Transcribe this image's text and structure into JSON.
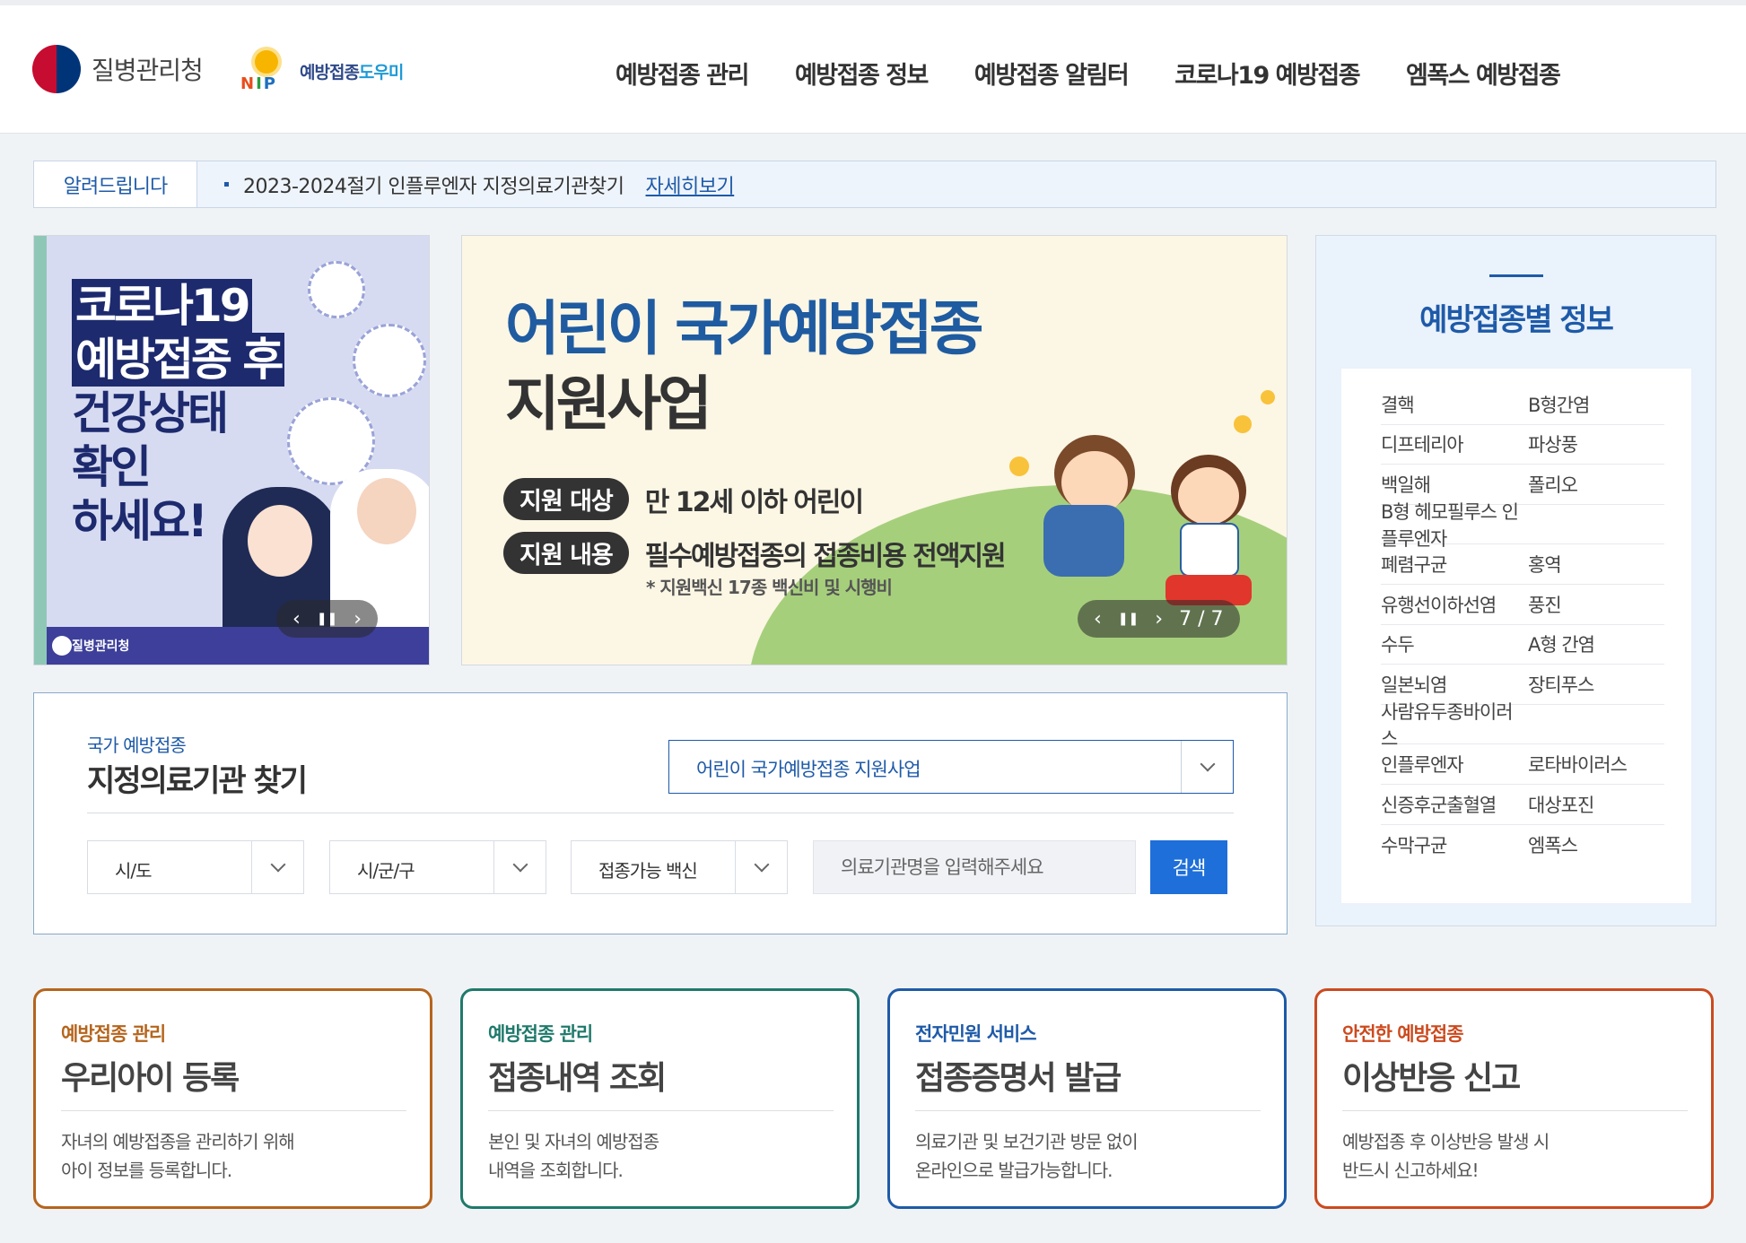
{
  "header": {
    "kdca_logo_text": "질병관리청",
    "nip_letters": [
      "N",
      "I",
      "P"
    ],
    "nip_text_a": "예방접종",
    "nip_text_b": "도우미",
    "nav": [
      "예방접종 관리",
      "예방접종 정보",
      "예방접종 알림터",
      "코로나19 예방접종",
      "엠폭스 예방접종"
    ]
  },
  "notice": {
    "label": "알려드립니다",
    "text": "2023-2024절기 인플루엔자 지정의료기관찾기",
    "link": "자세히보기"
  },
  "banner_left": {
    "line1": "코로나19",
    "line2": "예방접종 후",
    "line3": "건강상태",
    "line4": "확인",
    "line5": "하세요!",
    "footer_logo_text": "질병관리청",
    "controls": {
      "prev": "‹",
      "pause": "❚❚",
      "next": "›"
    }
  },
  "banner_main": {
    "title_line1": "어린이 국가예방접종",
    "title_line2": "지원사업",
    "target_label": "지원 대상",
    "target_value": "만 12세 이하 어린이",
    "content_label": "지원 내용",
    "content_value": "필수예방접종의 접종비용 전액지원",
    "note": "* 지원백신 17종 백신비 및 시행비",
    "controls": {
      "prev": "‹",
      "pause": "❚❚",
      "next": "›",
      "counter": "7 / 7"
    }
  },
  "vaccine_info": {
    "title": "예방접종별 정보",
    "rows": [
      [
        "결핵",
        "B형간염"
      ],
      [
        "디프테리아",
        "파상풍"
      ],
      [
        "백일해",
        "폴리오"
      ],
      [
        "B형 헤모필루스 인플루엔자",
        ""
      ],
      [
        "폐렴구균",
        "홍역"
      ],
      [
        "유행선이하선염",
        "풍진"
      ],
      [
        "수두",
        "A형 간염"
      ],
      [
        "일본뇌염",
        "장티푸스"
      ],
      [
        "사람유두종바이러스",
        ""
      ],
      [
        "인플루엔자",
        "로타바이러스"
      ],
      [
        "신증후군출혈열",
        "대상포진"
      ],
      [
        "수막구균",
        "엠폭스"
      ]
    ]
  },
  "finder": {
    "subtitle": "국가 예방접종",
    "title": "지정의료기관 찾기",
    "program_select": "어린이 국가예방접종 지원사업",
    "sido": "시/도",
    "sigungu": "시/군/구",
    "vaccine": "접종가능 백신",
    "search_placeholder": "의료기관명을 입력해주세요",
    "search_button": "검색"
  },
  "cards": [
    {
      "sub": "예방접종 관리",
      "title": "우리아이 등록",
      "desc": "자녀의 예방접종을 관리하기 위해\n아이 정보를 등록합니다.",
      "color": "#b5651d"
    },
    {
      "sub": "예방접종 관리",
      "title": "접종내역 조회",
      "desc": "본인 및 자녀의 예방접종\n내역을 조회합니다.",
      "color": "#1f7a6b"
    },
    {
      "sub": "전자민원 서비스",
      "title": "접종증명서 발급",
      "desc": "의료기관 및 보건기관 방문 없이\n온라인으로 발급가능합니다.",
      "color": "#1e5aa8"
    },
    {
      "sub": "안전한 예방접종",
      "title": "이상반응 신고",
      "desc": "예방접종 후 이상반응 발생 시\n반드시 신고하세요!",
      "color": "#cc4a1e"
    }
  ],
  "colors": {
    "primary": "#1e5aa8",
    "button": "#1e6fd9"
  }
}
